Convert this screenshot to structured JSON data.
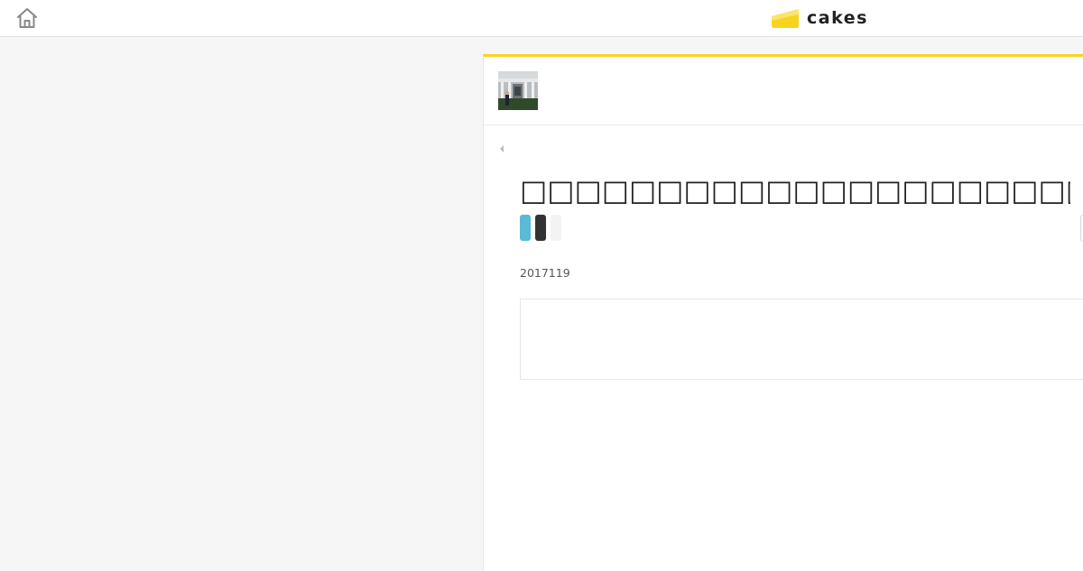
{
  "header": {
    "home_icon": "home-icon",
    "logo": {
      "text": "cakes",
      "icon": "cake-slice-icon",
      "accent": "#f8d31e"
    }
  },
  "article": {
    "series_thumbnail": "white-house-photo",
    "back_icon": "caret-left-icon",
    "title": "□□□□□□□□□□□□□□□□□□□□□□□□□□□□□□□□□□",
    "share_buttons": [
      {
        "name": "twitter-share",
        "color": "#5bbad5"
      },
      {
        "name": "dark-share",
        "color": "#333333"
      },
      {
        "name": "light-share",
        "color": "#f3f3f3"
      }
    ],
    "date": "2017119",
    "summary": ""
  },
  "colors": {
    "accent": "#f8d31e",
    "background": "#f6f6f6",
    "panel": "#ffffff"
  }
}
